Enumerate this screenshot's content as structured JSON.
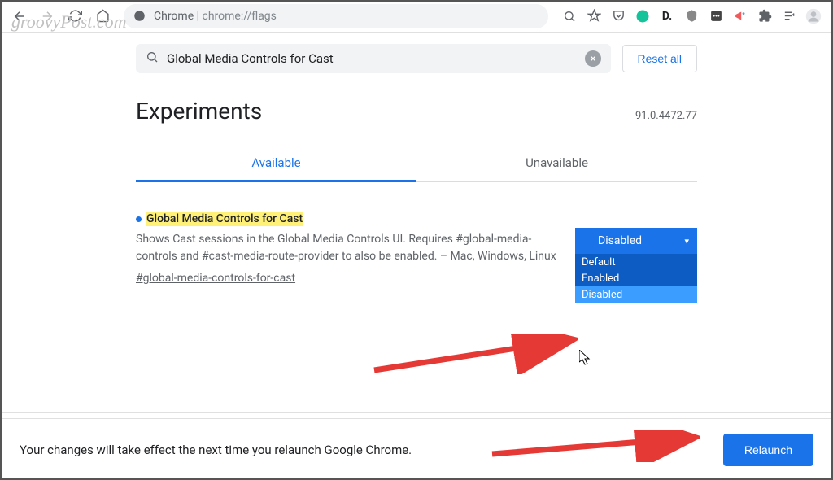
{
  "watermark": "groovyPost.com",
  "addressbar": {
    "label": "Chrome",
    "url": "chrome://flags"
  },
  "search": {
    "value": "Global Media Controls for Cast"
  },
  "reset_label": "Reset all",
  "page_title": "Experiments",
  "version": "91.0.4472.77",
  "tabs": {
    "available": "Available",
    "unavailable": "Unavailable"
  },
  "flag": {
    "title": "Global Media Controls for Cast",
    "description": "Shows Cast sessions in the Global Media Controls UI. Requires #global-media-controls and #cast-media-route-provider to also be enabled. – Mac, Windows, Linux",
    "hash": "#global-media-controls-for-cast"
  },
  "dropdown": {
    "selected": "Disabled",
    "options": [
      "Default",
      "Enabled",
      "Disabled"
    ]
  },
  "relaunch": {
    "message": "Your changes will take effect the next time you relaunch Google Chrome.",
    "button": "Relaunch"
  }
}
